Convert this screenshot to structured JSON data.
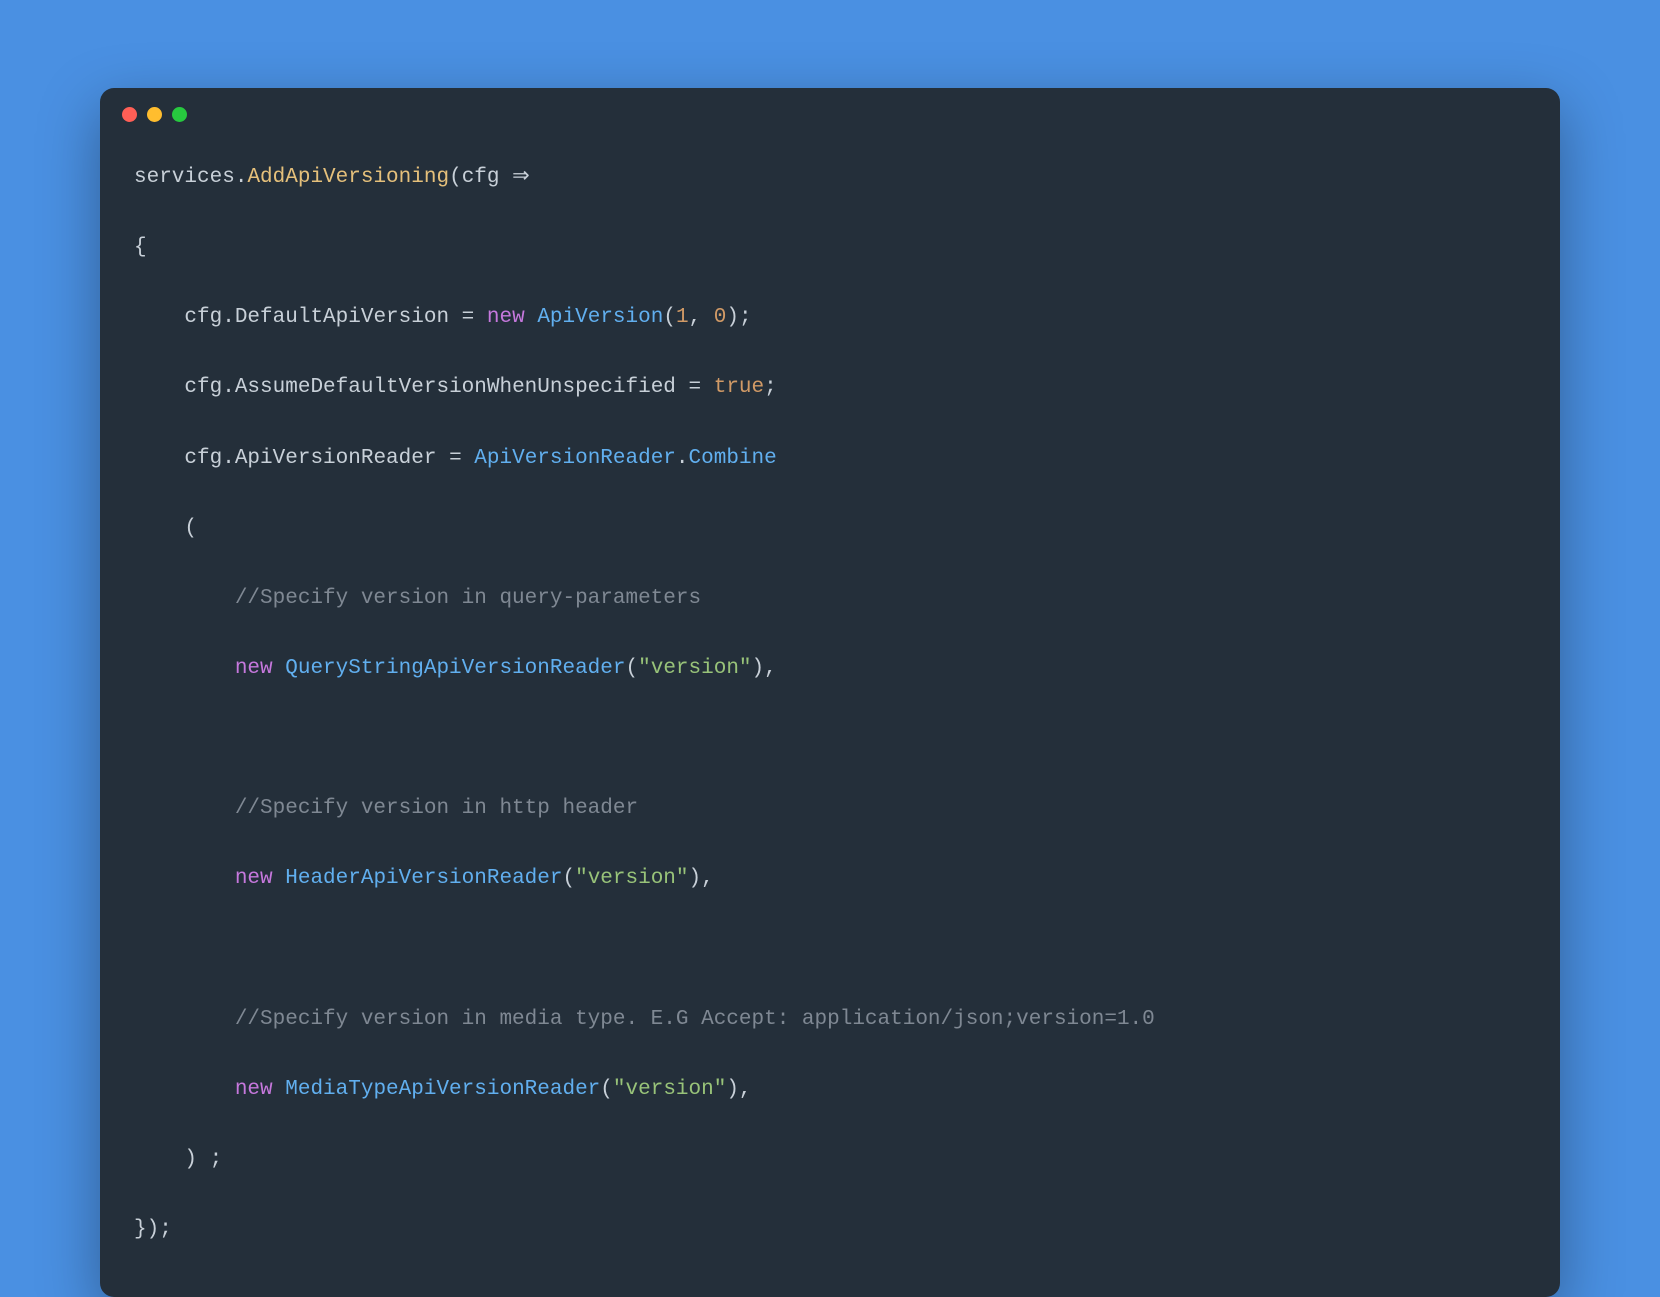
{
  "code": {
    "line1_services": "services",
    "line1_dot": ".",
    "line1_addapi": "AddApiVersioning",
    "line1_open": "(",
    "line1_cfg": "cfg",
    "line1_arrow": " ⇒",
    "line2_brace": "{",
    "line3_cfg": "cfg",
    "line3_dot": ".",
    "line3_defaultApi": "DefaultApiVersion",
    "line3_eq": " = ",
    "line3_new": "new",
    "line3_sp": " ",
    "line3_apiversion": "ApiVersion",
    "line3_open": "(",
    "line3_num1": "1",
    "line3_comma": ", ",
    "line3_num0": "0",
    "line3_close": ");",
    "line4_cfg": "cfg",
    "line4_dot": ".",
    "line4_assume": "AssumeDefaultVersionWhenUnspecified",
    "line4_eq": " = ",
    "line4_true": "true",
    "line4_semi": ";",
    "line5_cfg": "cfg",
    "line5_dot": ".",
    "line5_reader": "ApiVersionReader",
    "line5_eq": " = ",
    "line5_readerType": "ApiVersionReader",
    "line5_dot2": ".",
    "line5_combine": "Combine",
    "line6_open": "(",
    "line7_comment": "//Specify version in query-parameters",
    "line8_new": "new",
    "line8_sp": " ",
    "line8_type": "QueryStringApiVersionReader",
    "line8_open": "(",
    "line8_str": "\"version\"",
    "line8_close": "),",
    "line10_comment": "//Specify version in http header",
    "line11_new": "new",
    "line11_sp": " ",
    "line11_type": "HeaderApiVersionReader",
    "line11_open": "(",
    "line11_str": "\"version\"",
    "line11_close": "),",
    "line13_comment": "//Specify version in media type. E.G Accept: application/json;version=1.0",
    "line14_new": "new",
    "line14_sp": " ",
    "line14_type": "MediaTypeApiVersionReader",
    "line14_open": "(",
    "line14_str": "\"version\"",
    "line14_close": "),",
    "line15_close": ") ;",
    "line16_close": "});"
  }
}
